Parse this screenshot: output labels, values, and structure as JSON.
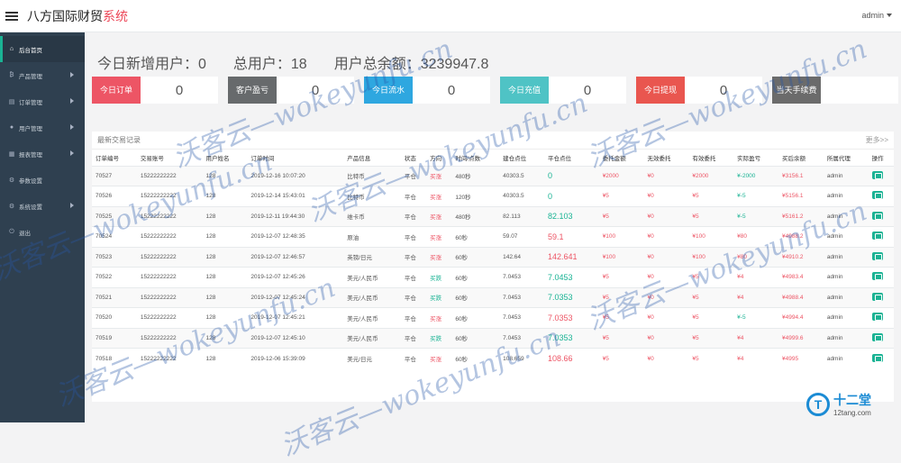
{
  "brand": {
    "name_prefix": "八方国际财贸",
    "name_suffix": "系统"
  },
  "header": {
    "user": "admin"
  },
  "sidebar": [
    {
      "label": "后台首页",
      "icon": "home-icon",
      "glyph": "⌂",
      "active": true,
      "arrow": false
    },
    {
      "label": "产品管理",
      "icon": "bitcoin-icon",
      "glyph": "₿",
      "active": false,
      "arrow": true
    },
    {
      "label": "订单管理",
      "icon": "order-icon",
      "glyph": "▤",
      "active": false,
      "arrow": true
    },
    {
      "label": "用户管理",
      "icon": "user-icon",
      "glyph": "●",
      "active": false,
      "arrow": true
    },
    {
      "label": "报表管理",
      "icon": "report-icon",
      "glyph": "▦",
      "active": false,
      "arrow": true
    },
    {
      "label": "参数设置",
      "icon": "settings-icon",
      "glyph": "⚙",
      "active": false,
      "arrow": false
    },
    {
      "label": "系统设置",
      "icon": "gear-icon",
      "glyph": "⚙",
      "active": false,
      "arrow": true
    },
    {
      "label": "退出",
      "icon": "logout-icon",
      "glyph": "⏻",
      "active": false,
      "arrow": false
    }
  ],
  "summary": {
    "new_users": "今日新增用户：0",
    "total_users": "总用户：18",
    "total_balance": "用户总余额：3239947.8"
  },
  "cards": [
    {
      "label": "今日订单",
      "value": "0",
      "color": "#ed5565"
    },
    {
      "label": "客户盈亏",
      "value": "0",
      "color": "#676a6c"
    },
    {
      "label": "今日流水",
      "value": "0",
      "color": "#2ea7e0"
    },
    {
      "label": "今日充值",
      "value": "0",
      "color": "#4fc3c5"
    },
    {
      "label": "今日提现",
      "value": "0",
      "color": "#e9564f"
    },
    {
      "label": "当天手续费",
      "value": "",
      "color": "#6b6b6b"
    }
  ],
  "panel": {
    "title": "最新交易记录",
    "more": "更多>>"
  },
  "table": {
    "headers": [
      "订单编号",
      "交易账号",
      "用户姓名",
      "订单时间",
      "产品信息",
      "状态",
      "方向",
      "时间/点数",
      "建仓点位",
      "平仓点位",
      "委托金额",
      "无效委托",
      "有效委托",
      "实际盈亏",
      "买后余额",
      "所属代理",
      "操作"
    ],
    "rows": [
      {
        "id": "70527",
        "account": "15222222222",
        "name": "128",
        "time": "2019-12-16 10:07:20",
        "product": "比特币",
        "status": "平仓",
        "dir": "买涨",
        "dir_color": "red",
        "period": "480秒",
        "open": "40303.5",
        "close": "0",
        "close_color": "green",
        "amount": "¥2000",
        "invalid": "¥0",
        "valid": "¥2000",
        "pnl": "¥-2000",
        "pnl_color": "green",
        "balance": "¥3156.1",
        "agent": "admin"
      },
      {
        "id": "70526",
        "account": "15222222222",
        "name": "128",
        "time": "2019-12-14 15:43:01",
        "product": "比特币",
        "status": "平仓",
        "dir": "买涨",
        "dir_color": "red",
        "period": "120秒",
        "open": "40303.5",
        "close": "0",
        "close_color": "green",
        "amount": "¥5",
        "invalid": "¥0",
        "valid": "¥5",
        "pnl": "¥-5",
        "pnl_color": "green",
        "balance": "¥5156.1",
        "agent": "admin"
      },
      {
        "id": "70525",
        "account": "15222222222",
        "name": "128",
        "time": "2019-12-11 19:44:30",
        "product": "维卡币",
        "status": "平仓",
        "dir": "买涨",
        "dir_color": "red",
        "period": "480秒",
        "open": "82.113",
        "close": "82.103",
        "close_color": "green",
        "amount": "¥5",
        "invalid": "¥0",
        "valid": "¥5",
        "pnl": "¥-5",
        "pnl_color": "green",
        "balance": "¥5161.2",
        "agent": "admin"
      },
      {
        "id": "70524",
        "account": "15222222222",
        "name": "128",
        "time": "2019-12-07 12:48:35",
        "product": "原油",
        "status": "平仓",
        "dir": "买涨",
        "dir_color": "red",
        "period": "60秒",
        "open": "59.07",
        "close": "59.1",
        "close_color": "red",
        "amount": "¥100",
        "invalid": "¥0",
        "valid": "¥100",
        "pnl": "¥80",
        "pnl_color": "red",
        "balance": "¥4988.2",
        "agent": "admin"
      },
      {
        "id": "70523",
        "account": "15222222222",
        "name": "128",
        "time": "2019-12-07 12:46:57",
        "product": "英镑/日元",
        "status": "平仓",
        "dir": "买涨",
        "dir_color": "red",
        "period": "60秒",
        "open": "142.64",
        "close": "142.641",
        "close_color": "red",
        "amount": "¥100",
        "invalid": "¥0",
        "valid": "¥100",
        "pnl": "¥80",
        "pnl_color": "red",
        "balance": "¥4910.2",
        "agent": "admin"
      },
      {
        "id": "70522",
        "account": "15222222222",
        "name": "128",
        "time": "2019-12-07 12:45:26",
        "product": "美元/人民币",
        "status": "平仓",
        "dir": "买跌",
        "dir_color": "green",
        "period": "60秒",
        "open": "7.0453",
        "close": "7.0453",
        "close_color": "green",
        "amount": "¥5",
        "invalid": "¥0",
        "valid": "¥5",
        "pnl": "¥4",
        "pnl_color": "red",
        "balance": "¥4983.4",
        "agent": "admin"
      },
      {
        "id": "70521",
        "account": "15222222222",
        "name": "128",
        "time": "2019-12-07 12:45:24",
        "product": "美元/人民币",
        "status": "平仓",
        "dir": "买跌",
        "dir_color": "green",
        "period": "60秒",
        "open": "7.0453",
        "close": "7.0353",
        "close_color": "green",
        "amount": "¥5",
        "invalid": "¥0",
        "valid": "¥5",
        "pnl": "¥4",
        "pnl_color": "red",
        "balance": "¥4988.4",
        "agent": "admin"
      },
      {
        "id": "70520",
        "account": "15222222222",
        "name": "128",
        "time": "2019-12-07 12:45:21",
        "product": "美元/人民币",
        "status": "平仓",
        "dir": "买涨",
        "dir_color": "red",
        "period": "60秒",
        "open": "7.0453",
        "close": "7.0353",
        "close_color": "red",
        "amount": "¥5",
        "invalid": "¥0",
        "valid": "¥5",
        "pnl": "¥-5",
        "pnl_color": "green",
        "balance": "¥4994.4",
        "agent": "admin"
      },
      {
        "id": "70519",
        "account": "15222222222",
        "name": "128",
        "time": "2019-12-07 12:45:10",
        "product": "美元/人民币",
        "status": "平仓",
        "dir": "买跌",
        "dir_color": "green",
        "period": "60秒",
        "open": "7.0453",
        "close": "7.0353",
        "close_color": "green",
        "amount": "¥5",
        "invalid": "¥0",
        "valid": "¥5",
        "pnl": "¥4",
        "pnl_color": "red",
        "balance": "¥4999.6",
        "agent": "admin"
      },
      {
        "id": "70518",
        "account": "15222222222",
        "name": "128",
        "time": "2019-12-06 15:39:09",
        "product": "美元/日元",
        "status": "平仓",
        "dir": "买涨",
        "dir_color": "red",
        "period": "60秒",
        "open": "108.659",
        "close": "108.66",
        "close_color": "red",
        "amount": "¥5",
        "invalid": "¥0",
        "valid": "¥5",
        "pnl": "¥4",
        "pnl_color": "red",
        "balance": "¥4995",
        "agent": "admin"
      }
    ]
  },
  "watermark": "沃客云—wokeyunfu.cn",
  "corner_logo": {
    "big": "十二堂",
    "small": "12tang.com"
  }
}
